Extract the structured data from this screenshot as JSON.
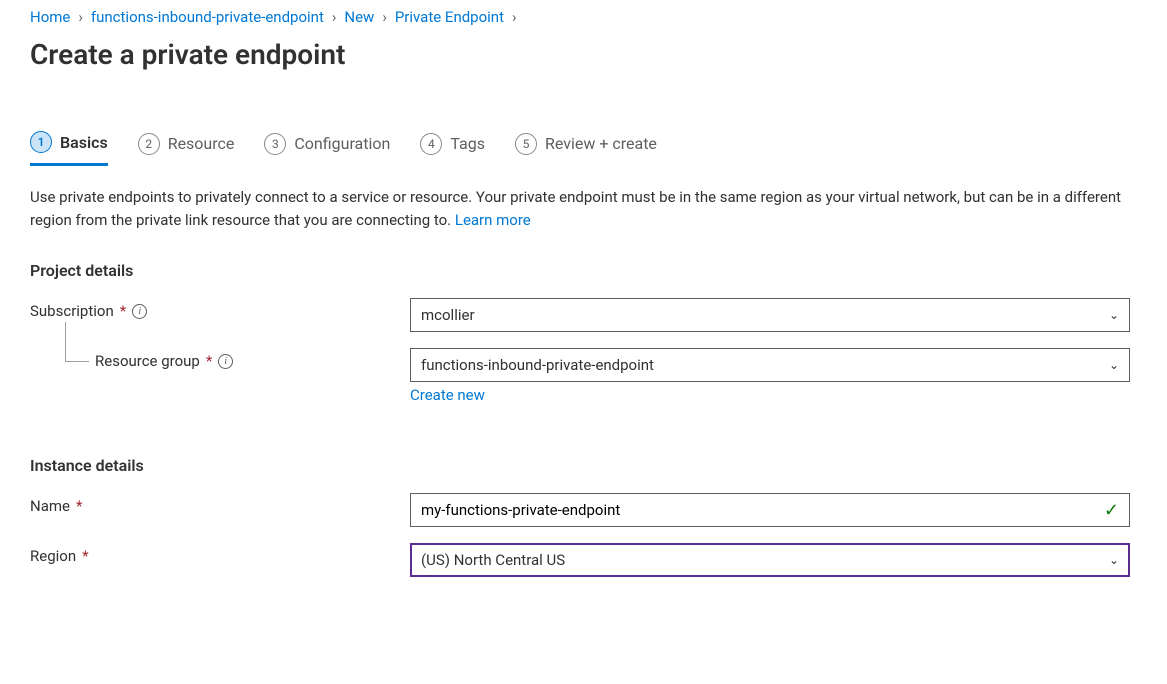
{
  "breadcrumb": {
    "items": [
      {
        "label": "Home"
      },
      {
        "label": "functions-inbound-private-endpoint"
      },
      {
        "label": "New"
      },
      {
        "label": "Private Endpoint"
      }
    ]
  },
  "page": {
    "title": "Create a private endpoint"
  },
  "tabs": [
    {
      "num": "1",
      "label": "Basics",
      "active": true
    },
    {
      "num": "2",
      "label": "Resource"
    },
    {
      "num": "3",
      "label": "Configuration"
    },
    {
      "num": "4",
      "label": "Tags"
    },
    {
      "num": "5",
      "label": "Review + create"
    }
  ],
  "intro": {
    "text": "Use private endpoints to privately connect to a service or resource. Your private endpoint must be in the same region as your virtual network, but can be in a different region from the private link resource that you are connecting to. ",
    "learn_more": "Learn more"
  },
  "sections": {
    "project": {
      "heading": "Project details",
      "subscription_label": "Subscription",
      "subscription_value": "mcollier",
      "resource_group_label": "Resource group",
      "resource_group_value": "functions-inbound-private-endpoint",
      "create_new": "Create new"
    },
    "instance": {
      "heading": "Instance details",
      "name_label": "Name",
      "name_value": "my-functions-private-endpoint",
      "region_label": "Region",
      "region_value": "(US) North Central US"
    }
  }
}
